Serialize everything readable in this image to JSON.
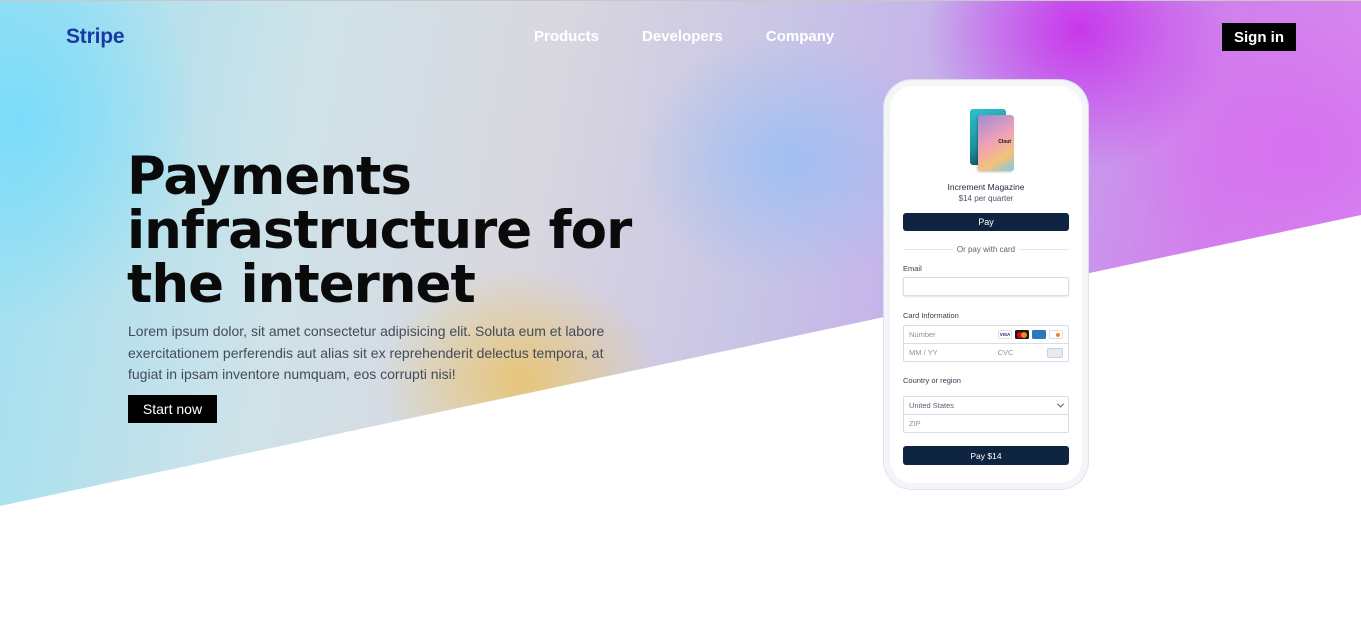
{
  "header": {
    "logo": "Stripe",
    "nav": [
      "Products",
      "Developers",
      "Company"
    ],
    "signin_label": "Sign in"
  },
  "hero": {
    "headline_lines": [
      "Payments",
      "infrastructure for",
      "the internet"
    ],
    "lede": "Lorem ipsum dolor, sit amet consectetur adipisicing elit. Soluta eum et labore exercitationem perferendis aut alias sit ex reprehenderit delectus tempora, at fugiat in ipsam inventore numquam, eos corrupti nisi!",
    "cta_label": "Start now"
  },
  "checkout": {
    "product_name": "Increment Magazine",
    "price": "$14 per quarter",
    "applepay_label": " Pay",
    "divider_text": "Or pay with card",
    "email_label": "Email",
    "email_value": "",
    "card_label": "Card Information",
    "card_number_placeholder": "Number",
    "card_brand_icons": [
      "visa-icon",
      "mastercard-icon",
      "amex-icon",
      "discover-icon"
    ],
    "visa_text": "VISA",
    "expiry_placeholder": "MM / YY",
    "cvc_placeholder": "CVC",
    "country_label": "Country or region",
    "country_value": "United States",
    "zip_placeholder": "ZIP",
    "pay_label": "Pay $14"
  },
  "colors": {
    "logo": "#1a3aa3",
    "button_dark": "#000000",
    "checkout_button": "#0f2440"
  }
}
